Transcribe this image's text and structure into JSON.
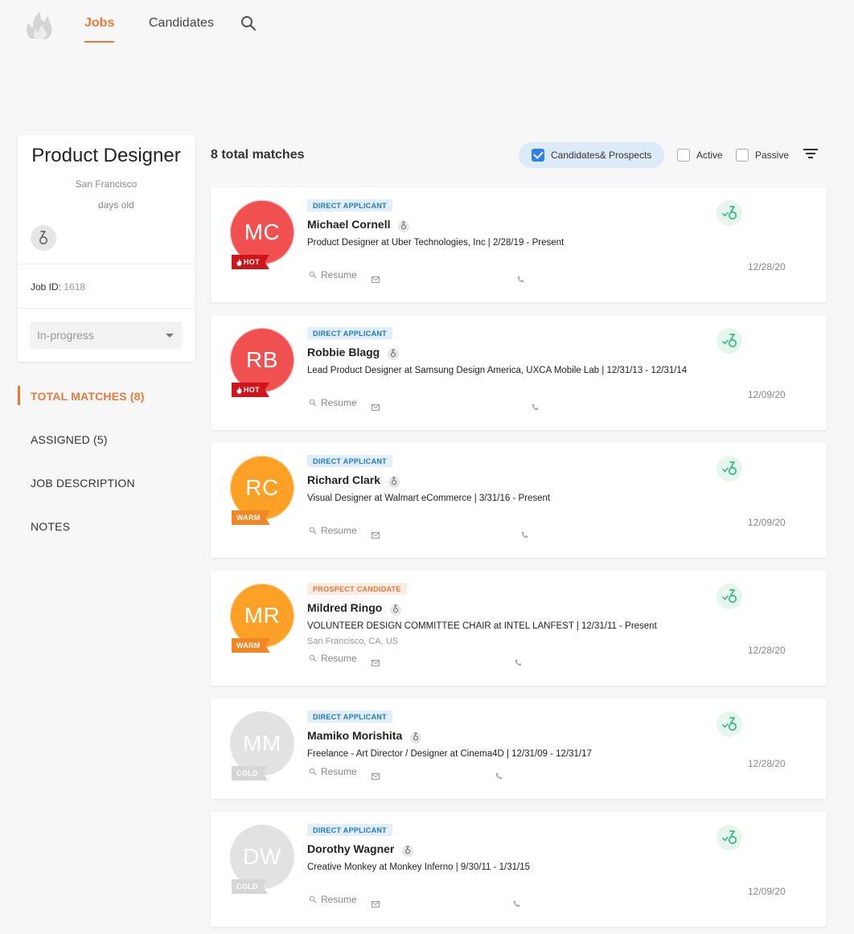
{
  "nav": {
    "tabs": [
      {
        "label": "Jobs",
        "active": true
      },
      {
        "label": "Candidates",
        "active": false
      }
    ],
    "search_icon": "search-icon",
    "logo_icon": "flame-logo"
  },
  "job": {
    "title": "Product Designer",
    "location": "San Francisco",
    "age_label": "days old",
    "id_label": "Job ID:",
    "id_value": "1618",
    "status": "In-progress"
  },
  "menu": {
    "items": [
      {
        "label": "TOTAL MATCHES (8)",
        "active": true
      },
      {
        "label": "ASSIGNED (5)",
        "active": false
      },
      {
        "label": "JOB DESCRIPTION",
        "active": false
      },
      {
        "label": "NOTES",
        "active": false
      }
    ]
  },
  "results": {
    "count_label": "8 total matches",
    "filters": {
      "candidates_prospects": {
        "label": "Candidates& Prospects",
        "checked": true
      },
      "active": {
        "label": "Active",
        "checked": false
      },
      "passive": {
        "label": "Passive",
        "checked": false
      }
    }
  },
  "colors": {
    "accent": "#e8793a",
    "hot": "#f0504f",
    "hot_tag": "#d0141b",
    "warm": "#fca126",
    "warm_tag": "#f28524",
    "cold": "#e2e2e2",
    "cold_tag": "#d6d6d6",
    "match_green": "#3cb98a"
  },
  "candidates": [
    {
      "initials": "MC",
      "temperature": "HOT",
      "type": "DIRECT APPLICANT",
      "name": "Michael Cornell",
      "role": "Product Designer at Uber Technologies, Inc  |  2/28/19 - Present",
      "location": "",
      "resume_label": "Resume",
      "date": "12/28/20"
    },
    {
      "initials": "RB",
      "temperature": "HOT",
      "type": "DIRECT APPLICANT",
      "name": "Robbie Blagg",
      "role": "Lead Product Designer at Samsung Design America, UXCA Mobile Lab  |  12/31/13 - 12/31/14",
      "location": "",
      "resume_label": "Resume",
      "date": "12/09/20"
    },
    {
      "initials": "RC",
      "temperature": "WARM",
      "type": "DIRECT APPLICANT",
      "name": "Richard Clark",
      "role": "Visual Designer at Walmart eCommerce  |  3/31/16 - Present",
      "location": "",
      "resume_label": "Resume",
      "date": "12/09/20"
    },
    {
      "initials": "MR",
      "temperature": "WARM",
      "type": "PROSPECT CANDIDATE",
      "name": "Mildred Ringo",
      "role": "VOLUNTEER DESIGN COMMITTEE CHAIR at INTEL LANFEST  |  12/31/11 - Present",
      "location": "San Francisco, CA, US",
      "resume_label": "Resume",
      "date": "12/28/20"
    },
    {
      "initials": "MM",
      "temperature": "COLD",
      "type": "DIRECT APPLICANT",
      "name": "Mamiko Morishita",
      "role": "Freelance - Art Director / Designer at Cinema4D  |  12/31/09 - 12/31/17",
      "location": "",
      "resume_label": "Resume",
      "date": "12/28/20"
    },
    {
      "initials": "DW",
      "temperature": "COLD",
      "type": "DIRECT APPLICANT",
      "name": "Dorothy Wagner",
      "role": "Creative Monkey at Monkey Inferno  |  9/30/11 - 1/31/15",
      "location": "",
      "resume_label": "Resume",
      "date": "12/09/20"
    }
  ]
}
